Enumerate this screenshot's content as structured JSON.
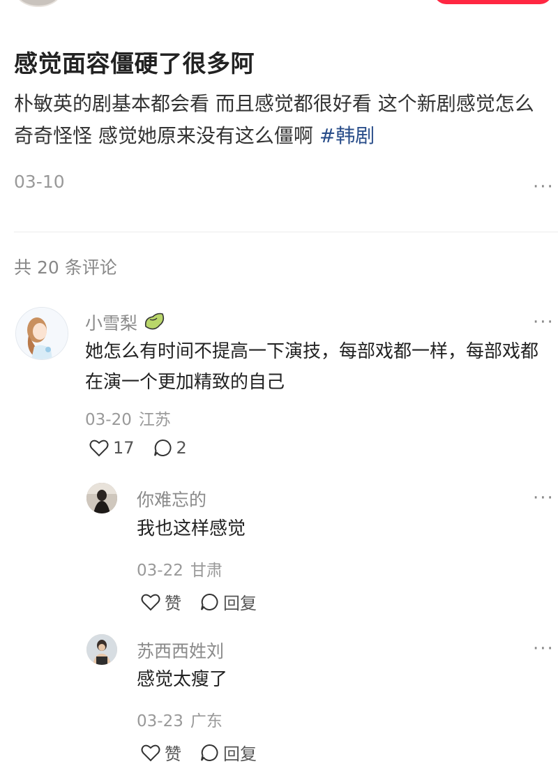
{
  "post": {
    "title": "感觉面容僵硬了很多阿",
    "body": "朴敏英的剧基本都会看 而且感觉都很好看 这个新剧感觉怎么奇奇怪怪 感觉她原来没有这么僵啊",
    "hashtag": "#韩剧",
    "date": "03-10",
    "more": "···"
  },
  "comments_header": "共 20 条评论",
  "comments": [
    {
      "name": "小雪梨",
      "badge": "pear-icon",
      "text": "她怎么有时间不提高一下演技，每部戏都一样，每部戏都在演一个更加精致的自己",
      "date": "03-20",
      "location": "江苏",
      "likes": "17",
      "replies": "2",
      "more": "···"
    }
  ],
  "replies": [
    {
      "name": "你难忘的",
      "text": "我也这样感觉",
      "date": "03-22",
      "location": "甘肃",
      "like_label": "赞",
      "reply_label": "回复",
      "more": "···"
    },
    {
      "name": "苏西西姓刘",
      "text": "感觉太瘦了",
      "date": "03-23",
      "location": "广东",
      "like_label": "赞",
      "reply_label": "回复",
      "more": "···"
    }
  ],
  "colors": {
    "hashtag": "#2a4e8a",
    "follow_button": "#ff2742",
    "meta": "#999999"
  }
}
